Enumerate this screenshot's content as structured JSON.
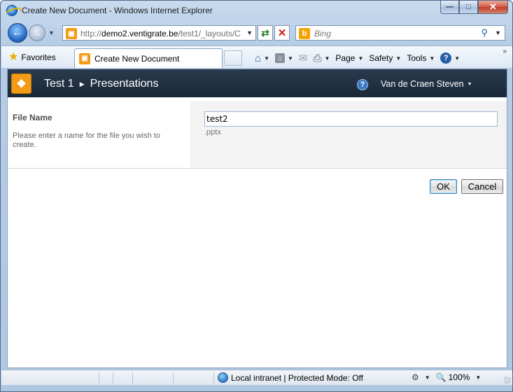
{
  "window": {
    "title": "Create New Document - Windows Internet Explorer",
    "minimize_icon": "minimize-icon",
    "maximize_icon": "maximize-icon",
    "close_icon": "close-icon"
  },
  "navigation": {
    "address_prefix": "http://",
    "address_host": "demo2.ventigrate.be",
    "address_path": "/test1/_layouts/C",
    "search_placeholder": "Bing"
  },
  "command_bar": {
    "favorites_label": "Favorites",
    "tab_title": "Create New Document",
    "page_label": "Page",
    "safety_label": "Safety",
    "tools_label": "Tools"
  },
  "sharepoint": {
    "breadcrumb": [
      "Test 1",
      "Presentations"
    ],
    "user_name": "Van de Craen Steven",
    "brand_color": "#f39b16",
    "header_color": "#223243"
  },
  "form": {
    "field_label": "File Name",
    "field_description": "Please enter a name for the file you wish to create.",
    "file_name_value": "test2",
    "extension": ".pptx",
    "ok_label": "OK",
    "cancel_label": "Cancel"
  },
  "status_bar": {
    "zone_text": "Local intranet | Protected Mode: Off",
    "zoom": "100%"
  }
}
